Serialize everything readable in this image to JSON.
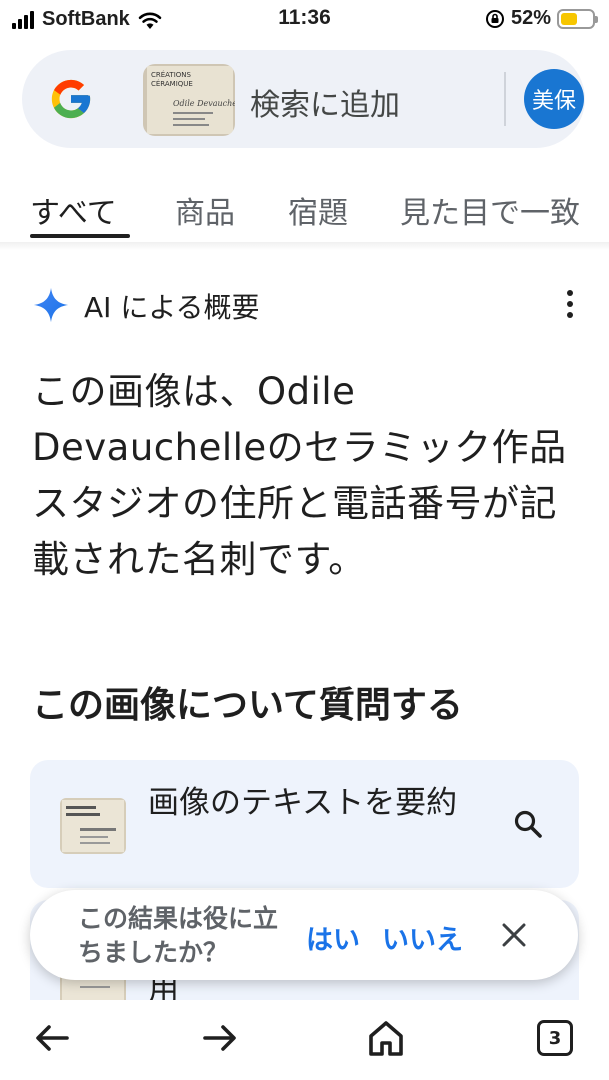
{
  "status_bar": {
    "carrier": "SoftBank",
    "time": "11:36",
    "battery_percent": "52%",
    "battery_level": 0.52,
    "battery_color": "#f7c600"
  },
  "search_bar": {
    "label": "検索に追加",
    "avatar_text": "美保",
    "avatar_color": "#1976d2",
    "thumbnail_text": {
      "line1": "CRÉATIONS",
      "line2": "CÉRAMIQUE",
      "signature": "Odile Devauchelle"
    }
  },
  "tabs": [
    {
      "label": "すべて",
      "active": true
    },
    {
      "label": "商品",
      "active": false
    },
    {
      "label": "宿題",
      "active": false
    },
    {
      "label": "見た目で一致",
      "active": false
    }
  ],
  "ai_overview": {
    "title": "AI による概要",
    "body": "この画像は、Odile Devauchelleのセラミック作品スタジオの住所と電話番号が記載された名刺です。"
  },
  "ask_section": {
    "heading": "この画像について質問する",
    "cards": [
      {
        "text": "画像のテキストを要約",
        "icon": "search-icon"
      },
      {
        "text": "用"
      }
    ]
  },
  "feedback_toast": {
    "question": "この結果は役に立ちましたか？",
    "yes": "はい",
    "no": "いいえ"
  },
  "bottom_nav": {
    "tab_count": "3",
    "icons": [
      "back-arrow-icon",
      "forward-arrow-icon",
      "home-icon",
      "tabs-icon"
    ]
  },
  "colors": {
    "accent": "#1a73e8",
    "search_bg": "#eef1f7",
    "card_bg": "#eef3fc"
  }
}
